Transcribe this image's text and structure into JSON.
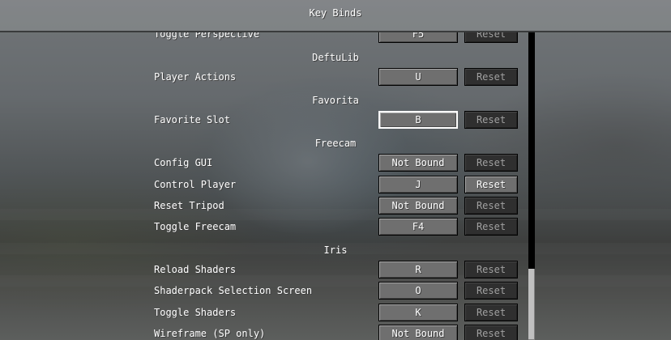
{
  "screen": {
    "title": "Key Binds"
  },
  "rows": [
    {
      "kind": "bind",
      "label": "Toggle Perspective",
      "key": "F5",
      "reset": "Reset",
      "reset_enabled": false,
      "focused": false
    },
    {
      "kind": "category",
      "label": "DeftuLib"
    },
    {
      "kind": "bind",
      "label": "Player Actions",
      "key": "U",
      "reset": "Reset",
      "reset_enabled": false,
      "focused": false
    },
    {
      "kind": "category",
      "label": "Favorita"
    },
    {
      "kind": "bind",
      "label": "Favorite Slot",
      "key": "B",
      "reset": "Reset",
      "reset_enabled": false,
      "focused": true
    },
    {
      "kind": "category",
      "label": "Freecam"
    },
    {
      "kind": "bind",
      "label": "Config GUI",
      "key": "Not Bound",
      "reset": "Reset",
      "reset_enabled": false,
      "focused": false
    },
    {
      "kind": "bind",
      "label": "Control Player",
      "key": "J",
      "reset": "Reset",
      "reset_enabled": true,
      "focused": false
    },
    {
      "kind": "bind",
      "label": "Reset Tripod",
      "key": "Not Bound",
      "reset": "Reset",
      "reset_enabled": false,
      "focused": false
    },
    {
      "kind": "bind",
      "label": "Toggle Freecam",
      "key": "F4",
      "reset": "Reset",
      "reset_enabled": false,
      "focused": false
    },
    {
      "kind": "category",
      "label": "Iris"
    },
    {
      "kind": "bind",
      "label": "Reload Shaders",
      "key": "R",
      "reset": "Reset",
      "reset_enabled": false,
      "focused": false
    },
    {
      "kind": "bind",
      "label": "Shaderpack Selection Screen",
      "key": "O",
      "reset": "Reset",
      "reset_enabled": false,
      "focused": false
    },
    {
      "kind": "bind",
      "label": "Toggle Shaders",
      "key": "K",
      "reset": "Reset",
      "reset_enabled": false,
      "focused": false
    },
    {
      "kind": "bind",
      "label": "Wireframe (SP only)",
      "key": "Not Bound",
      "reset": "Reset",
      "reset_enabled": false,
      "focused": false
    }
  ]
}
